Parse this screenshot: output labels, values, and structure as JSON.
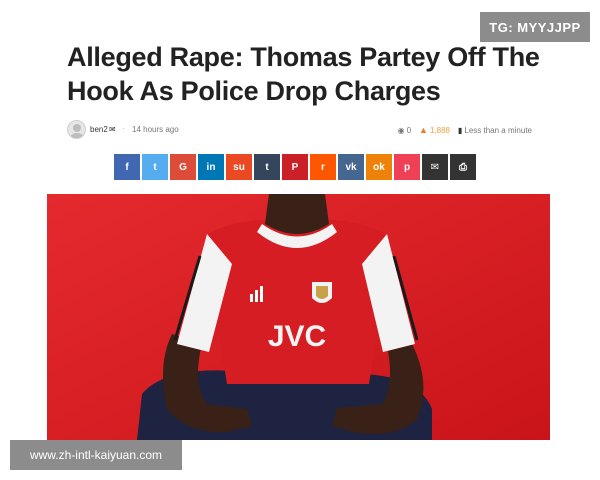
{
  "badge": {
    "text": "TG: MYYJJPP"
  },
  "article": {
    "headline": "Alleged Rape: Thomas Partey Off The Hook As Police Drop Charges",
    "meta": {
      "author": "ben2",
      "time": "14 hours ago",
      "comments": "0",
      "views": "1,888",
      "read_time": "Less than a minute"
    }
  },
  "share_buttons": [
    {
      "name": "facebook",
      "glyph": "f",
      "color": "#4267b2"
    },
    {
      "name": "twitter",
      "glyph": "t",
      "color": "#55acee"
    },
    {
      "name": "google",
      "glyph": "G",
      "color": "#dd4b39"
    },
    {
      "name": "linkedin",
      "glyph": "in",
      "color": "#0077b5"
    },
    {
      "name": "stumbleupon",
      "glyph": "su",
      "color": "#eb4924"
    },
    {
      "name": "tumblr",
      "glyph": "t",
      "color": "#35465c"
    },
    {
      "name": "pinterest",
      "glyph": "P",
      "color": "#cb2027"
    },
    {
      "name": "reddit",
      "glyph": "r",
      "color": "#ff5700"
    },
    {
      "name": "vk",
      "glyph": "vk",
      "color": "#45668e"
    },
    {
      "name": "odnoklassniki",
      "glyph": "ok",
      "color": "#ee8208"
    },
    {
      "name": "pocket",
      "glyph": "p",
      "color": "#ef4056"
    },
    {
      "name": "email",
      "glyph": "✉",
      "color": "#333333"
    },
    {
      "name": "print",
      "glyph": "⎙",
      "color": "#333333"
    }
  ],
  "photo": {
    "shirt_text": "JVC"
  },
  "watermark": {
    "text": "www.zh-intl-kaiyuan.com"
  }
}
